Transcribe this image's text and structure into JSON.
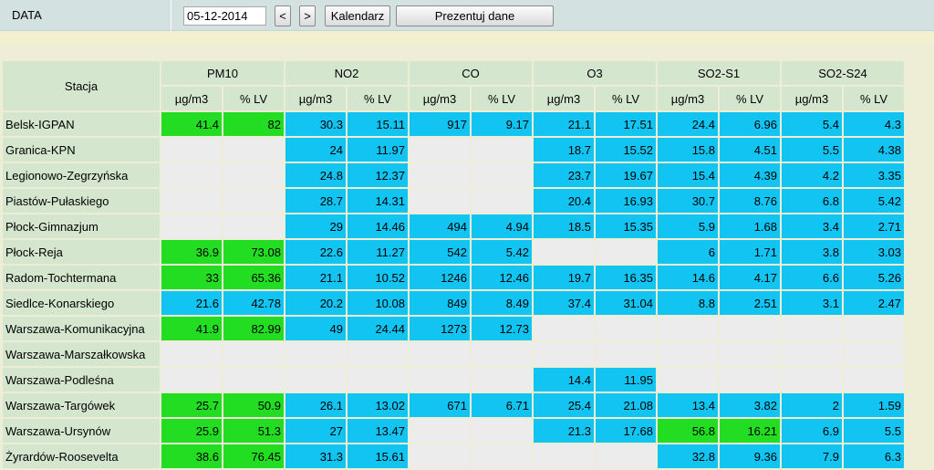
{
  "toolbar": {
    "label": "DATA",
    "date_value": "05-12-2014",
    "prev_label": "<",
    "next_label": ">",
    "calendar_label": "Kalendarz",
    "present_label": "Prezentuj dane"
  },
  "colors": {
    "green": "#22dd22",
    "blue": "#11c4f2",
    "empty": "#ececec",
    "header": "#d5e6cf"
  },
  "table": {
    "station_header": "Stacja",
    "groups": [
      "PM10",
      "NO2",
      "CO",
      "O3",
      "SO2-S1",
      "SO2-S24"
    ],
    "subheaders": [
      "µg/m3",
      "% LV"
    ],
    "rows": [
      {
        "name": "Belsk-IGPAN",
        "cells": [
          [
            "41.4",
            "g"
          ],
          [
            "82",
            "g"
          ],
          [
            "30.3",
            "b"
          ],
          [
            "15.11",
            "b"
          ],
          [
            "917",
            "b"
          ],
          [
            "9.17",
            "b"
          ],
          [
            "21.1",
            "b"
          ],
          [
            "17.51",
            "b"
          ],
          [
            "24.4",
            "b"
          ],
          [
            "6.96",
            "b"
          ],
          [
            "5.4",
            "b"
          ],
          [
            "4.3",
            "b"
          ]
        ]
      },
      {
        "name": "Granica-KPN",
        "cells": [
          [
            "",
            ""
          ],
          [
            "",
            ""
          ],
          [
            "24",
            "b"
          ],
          [
            "11.97",
            "b"
          ],
          [
            "",
            ""
          ],
          [
            "",
            ""
          ],
          [
            "18.7",
            "b"
          ],
          [
            "15.52",
            "b"
          ],
          [
            "15.8",
            "b"
          ],
          [
            "4.51",
            "b"
          ],
          [
            "5.5",
            "b"
          ],
          [
            "4.38",
            "b"
          ]
        ]
      },
      {
        "name": "Legionowo-Zegrzyńska",
        "cells": [
          [
            "",
            ""
          ],
          [
            "",
            ""
          ],
          [
            "24.8",
            "b"
          ],
          [
            "12.37",
            "b"
          ],
          [
            "",
            ""
          ],
          [
            "",
            ""
          ],
          [
            "23.7",
            "b"
          ],
          [
            "19.67",
            "b"
          ],
          [
            "15.4",
            "b"
          ],
          [
            "4.39",
            "b"
          ],
          [
            "4.2",
            "b"
          ],
          [
            "3.35",
            "b"
          ]
        ]
      },
      {
        "name": "Piastów-Pułaskiego",
        "cells": [
          [
            "",
            ""
          ],
          [
            "",
            ""
          ],
          [
            "28.7",
            "b"
          ],
          [
            "14.31",
            "b"
          ],
          [
            "",
            ""
          ],
          [
            "",
            ""
          ],
          [
            "20.4",
            "b"
          ],
          [
            "16.93",
            "b"
          ],
          [
            "30.7",
            "b"
          ],
          [
            "8.76",
            "b"
          ],
          [
            "6.8",
            "b"
          ],
          [
            "5.42",
            "b"
          ]
        ]
      },
      {
        "name": "Płock-Gimnazjum",
        "cells": [
          [
            "",
            ""
          ],
          [
            "",
            ""
          ],
          [
            "29",
            "b"
          ],
          [
            "14.46",
            "b"
          ],
          [
            "494",
            "b"
          ],
          [
            "4.94",
            "b"
          ],
          [
            "18.5",
            "b"
          ],
          [
            "15.35",
            "b"
          ],
          [
            "5.9",
            "b"
          ],
          [
            "1.68",
            "b"
          ],
          [
            "3.4",
            "b"
          ],
          [
            "2.71",
            "b"
          ]
        ]
      },
      {
        "name": "Płock-Reja",
        "cells": [
          [
            "36.9",
            "g"
          ],
          [
            "73.08",
            "g"
          ],
          [
            "22.6",
            "b"
          ],
          [
            "11.27",
            "b"
          ],
          [
            "542",
            "b"
          ],
          [
            "5.42",
            "b"
          ],
          [
            "",
            ""
          ],
          [
            "",
            ""
          ],
          [
            "6",
            "b"
          ],
          [
            "1.71",
            "b"
          ],
          [
            "3.8",
            "b"
          ],
          [
            "3.03",
            "b"
          ]
        ]
      },
      {
        "name": "Radom-Tochtermana",
        "cells": [
          [
            "33",
            "g"
          ],
          [
            "65.36",
            "g"
          ],
          [
            "21.1",
            "b"
          ],
          [
            "10.52",
            "b"
          ],
          [
            "1246",
            "b"
          ],
          [
            "12.46",
            "b"
          ],
          [
            "19.7",
            "b"
          ],
          [
            "16.35",
            "b"
          ],
          [
            "14.6",
            "b"
          ],
          [
            "4.17",
            "b"
          ],
          [
            "6.6",
            "b"
          ],
          [
            "5.26",
            "b"
          ]
        ]
      },
      {
        "name": "Siedlce-Konarskiego",
        "cells": [
          [
            "21.6",
            "b"
          ],
          [
            "42.78",
            "b"
          ],
          [
            "20.2",
            "b"
          ],
          [
            "10.08",
            "b"
          ],
          [
            "849",
            "b"
          ],
          [
            "8.49",
            "b"
          ],
          [
            "37.4",
            "b"
          ],
          [
            "31.04",
            "b"
          ],
          [
            "8.8",
            "b"
          ],
          [
            "2.51",
            "b"
          ],
          [
            "3.1",
            "b"
          ],
          [
            "2.47",
            "b"
          ]
        ]
      },
      {
        "name": "Warszawa-Komunikacyjna",
        "cells": [
          [
            "41.9",
            "g"
          ],
          [
            "82.99",
            "g"
          ],
          [
            "49",
            "b"
          ],
          [
            "24.44",
            "b"
          ],
          [
            "1273",
            "b"
          ],
          [
            "12.73",
            "b"
          ],
          [
            "",
            ""
          ],
          [
            "",
            ""
          ],
          [
            "",
            ""
          ],
          [
            "",
            ""
          ],
          [
            "",
            ""
          ],
          [
            "",
            ""
          ]
        ]
      },
      {
        "name": "Warszawa-Marszałkowska",
        "cells": [
          [
            "",
            ""
          ],
          [
            "",
            ""
          ],
          [
            "",
            ""
          ],
          [
            "",
            ""
          ],
          [
            "",
            ""
          ],
          [
            "",
            ""
          ],
          [
            "",
            ""
          ],
          [
            "",
            ""
          ],
          [
            "",
            ""
          ],
          [
            "",
            ""
          ],
          [
            "",
            ""
          ],
          [
            "",
            ""
          ]
        ]
      },
      {
        "name": "Warszawa-Podleśna",
        "cells": [
          [
            "",
            ""
          ],
          [
            "",
            ""
          ],
          [
            "",
            ""
          ],
          [
            "",
            ""
          ],
          [
            "",
            ""
          ],
          [
            "",
            ""
          ],
          [
            "14.4",
            "b"
          ],
          [
            "11.95",
            "b"
          ],
          [
            "",
            ""
          ],
          [
            "",
            ""
          ],
          [
            "",
            ""
          ],
          [
            "",
            ""
          ]
        ]
      },
      {
        "name": "Warszawa-Targówek",
        "cells": [
          [
            "25.7",
            "g"
          ],
          [
            "50.9",
            "g"
          ],
          [
            "26.1",
            "b"
          ],
          [
            "13.02",
            "b"
          ],
          [
            "671",
            "b"
          ],
          [
            "6.71",
            "b"
          ],
          [
            "25.4",
            "b"
          ],
          [
            "21.08",
            "b"
          ],
          [
            "13.4",
            "b"
          ],
          [
            "3.82",
            "b"
          ],
          [
            "2",
            "b"
          ],
          [
            "1.59",
            "b"
          ]
        ]
      },
      {
        "name": "Warszawa-Ursynów",
        "cells": [
          [
            "25.9",
            "g"
          ],
          [
            "51.3",
            "g"
          ],
          [
            "27",
            "b"
          ],
          [
            "13.47",
            "b"
          ],
          [
            "",
            ""
          ],
          [
            "",
            ""
          ],
          [
            "21.3",
            "b"
          ],
          [
            "17.68",
            "b"
          ],
          [
            "56.8",
            "g"
          ],
          [
            "16.21",
            "g"
          ],
          [
            "6.9",
            "b"
          ],
          [
            "5.5",
            "b"
          ]
        ]
      },
      {
        "name": "Żyrardów-Roosevelta",
        "cells": [
          [
            "38.6",
            "g"
          ],
          [
            "76.45",
            "g"
          ],
          [
            "31.3",
            "b"
          ],
          [
            "15.61",
            "b"
          ],
          [
            "",
            ""
          ],
          [
            "",
            ""
          ],
          [
            "",
            ""
          ],
          [
            "",
            ""
          ],
          [
            "32.8",
            "b"
          ],
          [
            "9.36",
            "b"
          ],
          [
            "7.9",
            "b"
          ],
          [
            "6.3",
            "b"
          ]
        ]
      }
    ]
  }
}
